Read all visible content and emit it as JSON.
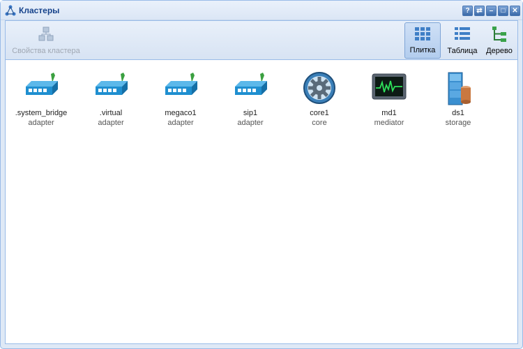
{
  "window": {
    "title": "Кластеры",
    "title_icon": "cluster-icon",
    "tools": [
      {
        "name": "help",
        "glyph": "?"
      },
      {
        "name": "refresh",
        "glyph": "⇄"
      },
      {
        "name": "minimize",
        "glyph": "–"
      },
      {
        "name": "maximize",
        "glyph": "□"
      },
      {
        "name": "close",
        "glyph": "✕"
      }
    ]
  },
  "toolbar": {
    "cluster_properties_label": "Свойства кластера",
    "tiles_label": "Плитка",
    "table_label": "Таблица",
    "tree_label": "Дерево",
    "active_view": "Плитка"
  },
  "clusters": [
    {
      "name": ".system_bridge",
      "type": "adapter",
      "icon": "adapter-icon"
    },
    {
      "name": ".virtual",
      "type": "adapter",
      "icon": "adapter-icon"
    },
    {
      "name": "megaco1",
      "type": "adapter",
      "icon": "adapter-icon"
    },
    {
      "name": "sip1",
      "type": "adapter",
      "icon": "adapter-icon"
    },
    {
      "name": "core1",
      "type": "core",
      "icon": "gear-icon"
    },
    {
      "name": "md1",
      "type": "mediator",
      "icon": "monitor-icon"
    },
    {
      "name": "ds1",
      "type": "storage",
      "icon": "storage-icon"
    }
  ],
  "colors": {
    "title_text": "#15428b",
    "frame": "#99bbe8",
    "adapter_blue": "#1f8fd0"
  }
}
